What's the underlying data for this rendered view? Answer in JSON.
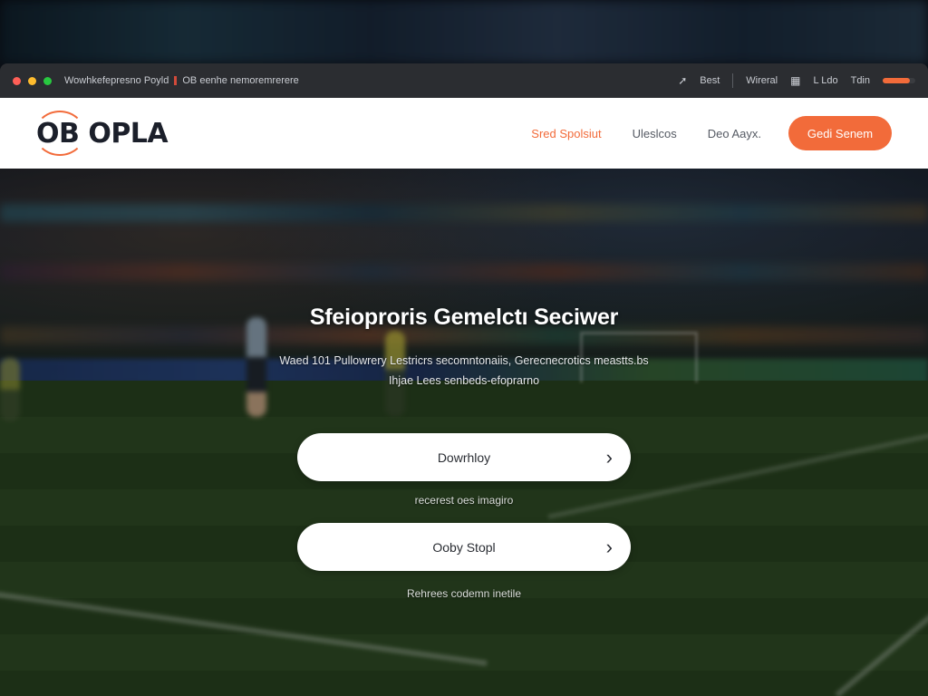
{
  "browser": {
    "tab_title": "Wowhkefepresno Poyld",
    "tab_title_2": "OB eenhe nemoremrerere",
    "right_items": [
      "Best",
      "Wireral",
      "L Ldo",
      "Tdin"
    ]
  },
  "header": {
    "logo": "OB OPLA",
    "nav": [
      "Sred Spolsiut",
      "Uleslcos",
      "Deo Aayx."
    ],
    "cta": "Gedi Senem"
  },
  "hero": {
    "title": "Sfeioproris Gemelctı Seciwer",
    "subtitle_line1": "Waed 101 Pullowrery  Lestricrs secomntonaiis, Gerecnecrotics meastts.bs",
    "subtitle_line2": "Ihjae Lees senbeds-efoprarno"
  },
  "actions": [
    {
      "label": "Dowrhloy",
      "caption": "recerest oes imagiro"
    },
    {
      "label": "Ooby Stopl",
      "caption": "Rehrees codemn inetile"
    }
  ],
  "colors": {
    "accent": "#f26b3a",
    "header_bg": "#ffffff",
    "chrome_bg": "#2b2d31"
  },
  "icons": {
    "nav_arrow": "arrow-icon",
    "chevron": "chevron-right-icon"
  }
}
